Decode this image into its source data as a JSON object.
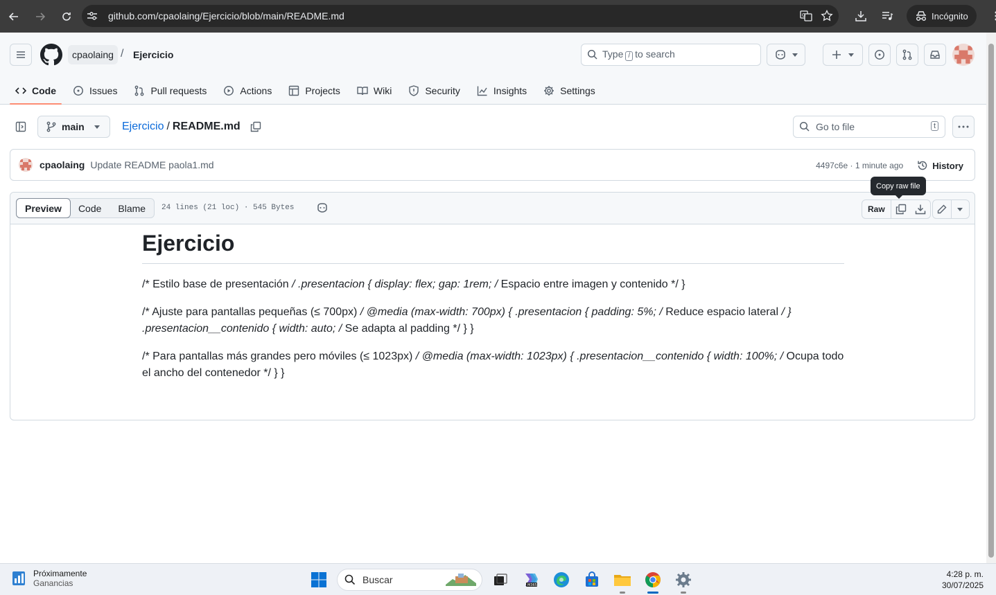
{
  "browser": {
    "url": "github.com/cpaolaing/Ejercicio/blob/main/README.md",
    "profile_label": "Incógnito"
  },
  "header": {
    "owner": "cpaolaing",
    "separator": "/",
    "repo": "Ejercicio",
    "search_prefix": "Type",
    "search_key": "/",
    "search_suffix": "to search"
  },
  "repo_nav": {
    "tabs": [
      {
        "label": "Code",
        "icon": "code-icon"
      },
      {
        "label": "Issues",
        "icon": "issue-icon"
      },
      {
        "label": "Pull requests",
        "icon": "pull-request-icon"
      },
      {
        "label": "Actions",
        "icon": "play-icon"
      },
      {
        "label": "Projects",
        "icon": "table-icon"
      },
      {
        "label": "Wiki",
        "icon": "book-icon"
      },
      {
        "label": "Security",
        "icon": "shield-icon"
      },
      {
        "label": "Insights",
        "icon": "graph-icon"
      },
      {
        "label": "Settings",
        "icon": "gear-icon"
      }
    ]
  },
  "file_nav": {
    "branch": "main",
    "repo_link": "Ejercicio",
    "path_sep": "/",
    "file_name": "README.md",
    "goto_placeholder": "Go to file",
    "goto_key": "t"
  },
  "commit": {
    "author": "cpaolaing",
    "message": "Update README paola1.md",
    "meta": "4497c6e · 1 minute ago",
    "history_label": "History"
  },
  "file_header": {
    "view_tabs": [
      "Preview",
      "Code",
      "Blame"
    ],
    "info": "24 lines (21 loc) · 545 Bytes",
    "raw_label": "Raw",
    "tooltip": "Copy raw file"
  },
  "readme": {
    "title": "Ejercicio",
    "p1_a": "/* Estilo base de presentación ",
    "p1_b": "/ .presentacion { display: flex; gap: 1rem; /",
    "p1_c": " Espacio entre imagen y contenido */ }",
    "p2_a": "/* Ajuste para pantallas pequeñas (≤ 700px) ",
    "p2_b": "/ @media (max-width: 700px) { .presentacion { padding: 5%; /",
    "p2_c": " Reduce espacio lateral ",
    "p2_d": "/ } .presentacion__contenido { width: auto; /",
    "p2_e": " Se adapta al padding */ } }",
    "p3_a": "/* Para pantallas más grandes pero móviles (≤ 1023px) ",
    "p3_b": "/ @media (max-width: 1023px) { .presentacion__contenido { width: 100%; /",
    "p3_c": " Ocupa todo el ancho del contenedor */ } }"
  },
  "taskbar": {
    "weather_title": "Próximamente",
    "weather_sub": "Ganancias",
    "search_placeholder": "Buscar",
    "time": "4:28 p. m.",
    "date": "30/07/2025"
  },
  "colors": {
    "accent": "#0969da",
    "tab_underline": "#fd8c73",
    "chrome_bg": "#3c3c3c"
  }
}
